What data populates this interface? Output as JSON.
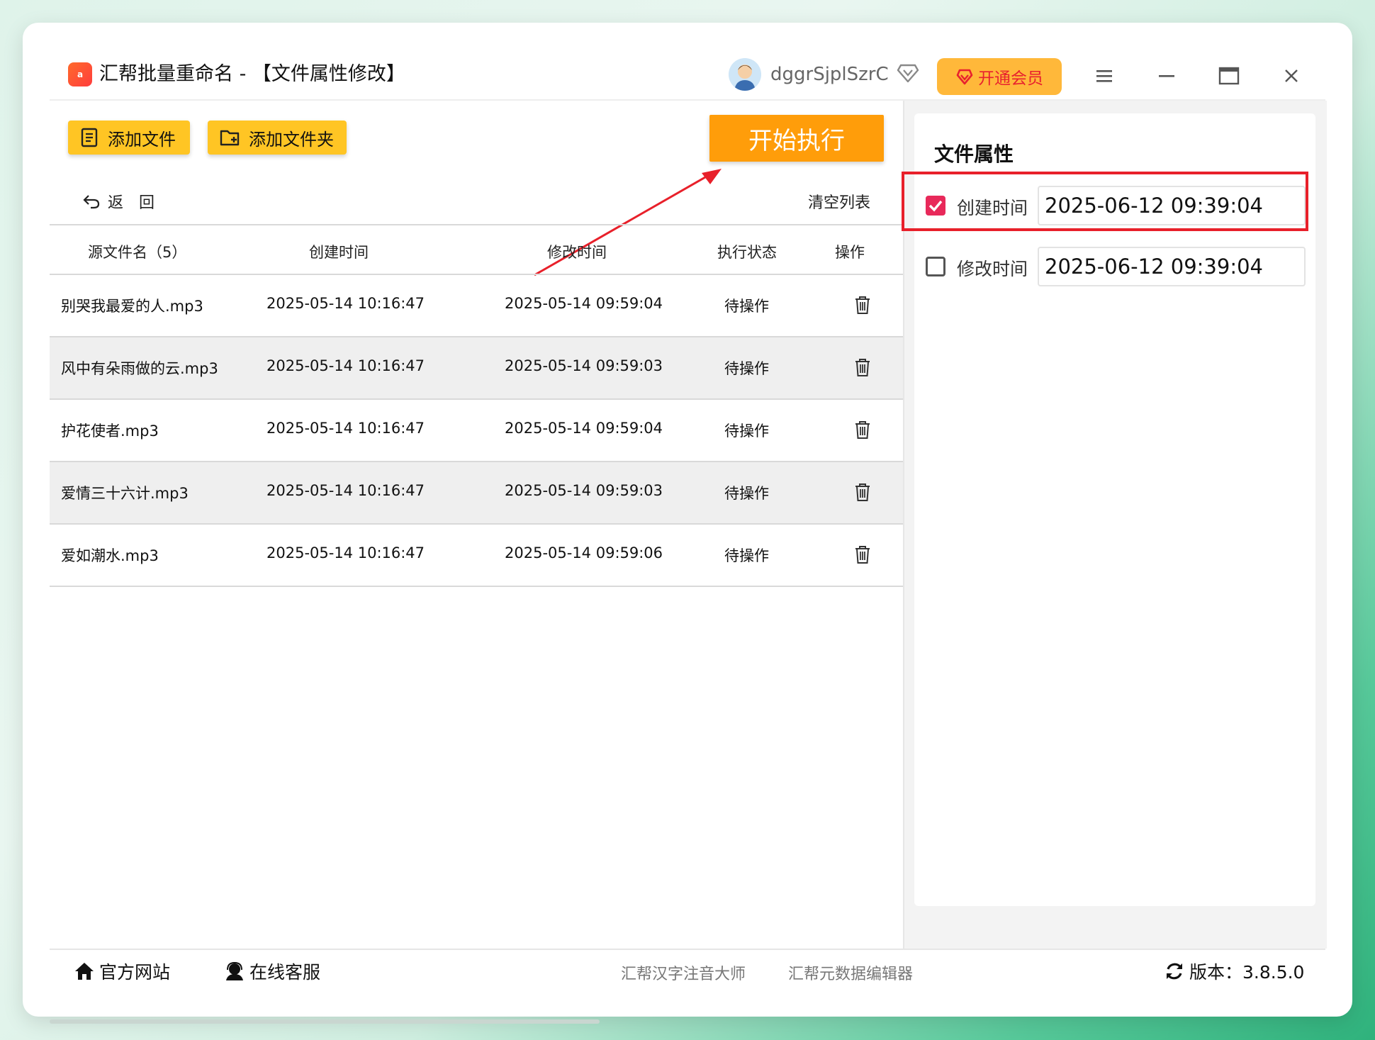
{
  "app": {
    "logo_text": "a",
    "title": "汇帮批量重命名 - 【文件属性修改】",
    "username": "dggrSjplSzrC",
    "vip_label": "开通会员"
  },
  "toolbar": {
    "add_file": "添加文件",
    "add_folder": "添加文件夹",
    "start": "开始执行",
    "back": "返　回",
    "clear": "清空列表"
  },
  "table": {
    "headers": [
      "源文件名（5）",
      "创建时间",
      "修改时间",
      "执行状态",
      "操作"
    ],
    "rows": [
      {
        "name": "别哭我最爱的人.mp3",
        "created": "2025-05-14 10:16:47",
        "modified": "2025-05-14 09:59:04",
        "status": "待操作"
      },
      {
        "name": "风中有朵雨做的云.mp3",
        "created": "2025-05-14 10:16:47",
        "modified": "2025-05-14 09:59:03",
        "status": "待操作"
      },
      {
        "name": "护花使者.mp3",
        "created": "2025-05-14 10:16:47",
        "modified": "2025-05-14 09:59:04",
        "status": "待操作"
      },
      {
        "name": "爱情三十六计.mp3",
        "created": "2025-05-14 10:16:47",
        "modified": "2025-05-14 09:59:03",
        "status": "待操作"
      },
      {
        "name": "爱如潮水.mp3",
        "created": "2025-05-14 10:16:47",
        "modified": "2025-05-14 09:59:06",
        "status": "待操作"
      }
    ]
  },
  "properties": {
    "title": "文件属性",
    "created": {
      "label": "创建时间",
      "checked": true,
      "value": "2025-06-12 09:39:04"
    },
    "modified": {
      "label": "修改时间",
      "checked": false,
      "value": "2025-06-12 09:39:04"
    }
  },
  "footer": {
    "website": "官方网站",
    "support": "在线客服",
    "link1": "汇帮汉字注音大师",
    "link2": "汇帮元数据编辑器",
    "version": "版本：3.8.5.0"
  },
  "colors": {
    "accent_yellow": "#ffc524",
    "start_orange": "#ff9d0a",
    "checkbox_on": "#e8295a",
    "highlight_red": "#e8202a"
  }
}
